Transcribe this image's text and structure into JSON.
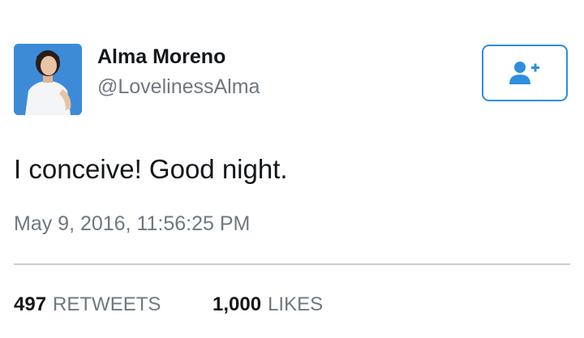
{
  "user": {
    "display_name": "Alma Moreno",
    "handle": "@LovelinessAlma"
  },
  "follow_button": {
    "icon": "follow-user-plus-icon",
    "color": "#2e8ee0"
  },
  "tweet": {
    "text": "I conceive! Good night.",
    "timestamp": "May 9, 2016, 11:56:25 PM"
  },
  "stats": {
    "retweets_count": "497",
    "retweets_label": "RETWEETS",
    "likes_count": "1,000",
    "likes_label": "LIKES"
  },
  "colors": {
    "text_primary": "#14171a",
    "text_secondary": "#6f7880",
    "divider": "#c9ced3",
    "avatar_background": "#2f7fd0"
  }
}
